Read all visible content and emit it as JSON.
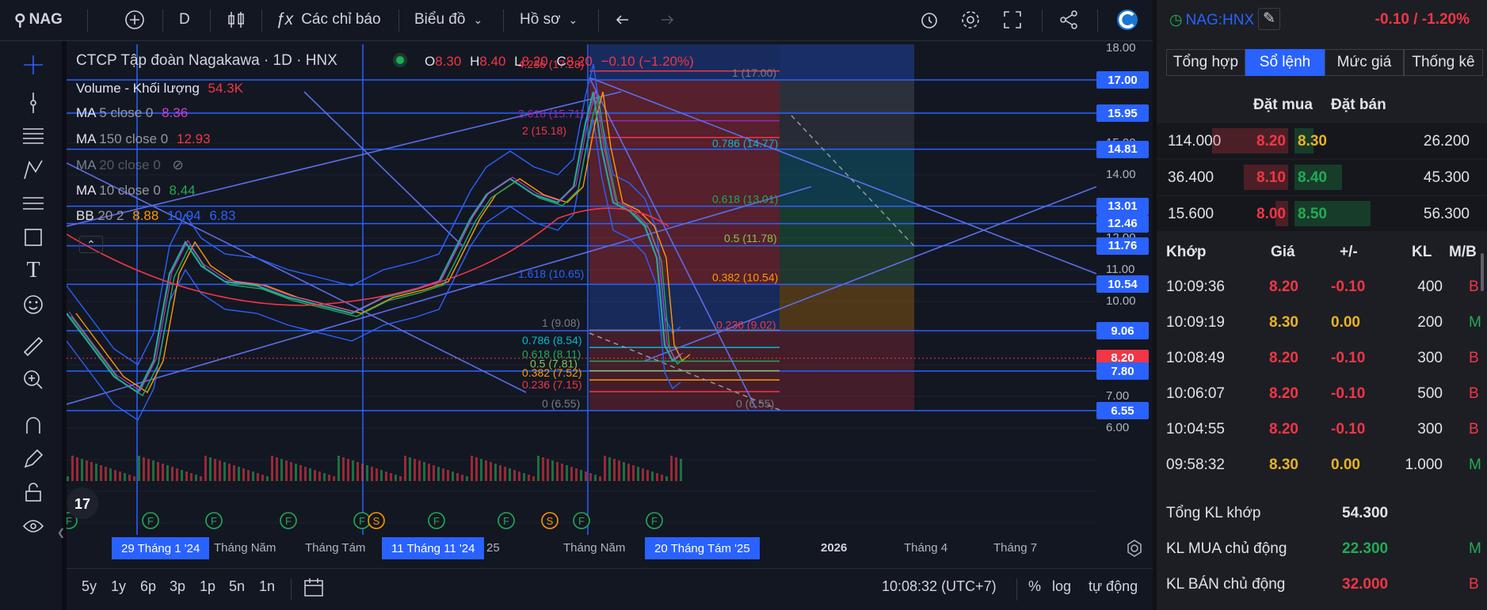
{
  "toolbar": {
    "symbol": "NAG",
    "interval": "D",
    "indicators_label": "Các chỉ báo",
    "chart_label": "Biểu đồ",
    "profile_label": "Hồ sơ"
  },
  "legend": {
    "title": "CTCP Tập đoàn Nagakawa · 1D · HNX",
    "ohlc": {
      "o": "8.30",
      "h": "8.40",
      "l": "8.20",
      "c": "8.20",
      "chg": "−0.10 (−1.20%)"
    },
    "volume": {
      "label": "Volume - Khối lượng",
      "value": "54.3K"
    },
    "indicators": [
      {
        "name": "MA",
        "params": "5 close 0",
        "values": [
          "8.36"
        ],
        "colors": [
          "#d33ad0"
        ]
      },
      {
        "name": "MA",
        "params": "150 close 0",
        "values": [
          "12.93"
        ],
        "colors": [
          "#f23645"
        ]
      },
      {
        "name": "MA",
        "params": "20 close 0",
        "values": [],
        "colors": []
      },
      {
        "name": "MA",
        "params": "10 close 0",
        "values": [
          "8.44"
        ],
        "colors": [
          "#22ab55"
        ]
      },
      {
        "name": "BB",
        "params": "20 2",
        "values": [
          "8.88",
          "10.94",
          "6.83"
        ],
        "colors": [
          "#ff9800",
          "#2962ff",
          "#2962ff"
        ]
      }
    ]
  },
  "price_axis": {
    "ticks": [
      "18.00",
      "15.00",
      "14.00",
      "12.00",
      "11.00",
      "10.00",
      "7.00",
      "6.00"
    ],
    "labels": [
      {
        "value": "17.00",
        "color": "#2962ff"
      },
      {
        "value": "15.95",
        "color": "#2962ff"
      },
      {
        "value": "14.81",
        "color": "#2962ff"
      },
      {
        "value": "13.01",
        "color": "#2962ff"
      },
      {
        "value": "12.46",
        "color": "#2962ff"
      },
      {
        "value": "11.76",
        "color": "#2962ff"
      },
      {
        "value": "10.54",
        "color": "#2962ff"
      },
      {
        "value": "9.06",
        "color": "#2962ff"
      },
      {
        "value": "8.20",
        "color": "#f23645"
      },
      {
        "value": "7.80",
        "color": "#2962ff"
      },
      {
        "value": "6.55",
        "color": "#2962ff"
      }
    ]
  },
  "fib_left": [
    {
      "label": "4.236 (17.28)",
      "color": "#f23645"
    },
    {
      "label": "2.618 (15.71)",
      "color": "#9c27b0"
    },
    {
      "label": "2 (15.18)",
      "color": "#f23645"
    },
    {
      "label": "1.618 (10.65)",
      "color": "#2962ff"
    },
    {
      "label": "1 (9.08)",
      "color": "#787b86"
    },
    {
      "label": "0.786 (8.54)",
      "color": "#00bcd4"
    },
    {
      "label": "0.618 (8.11)",
      "color": "#22ab55"
    },
    {
      "label": "0.5 (7.81)",
      "color": "#8bc34a"
    },
    {
      "label": "0.382 (7.52)",
      "color": "#ff9800"
    },
    {
      "label": "0.236 (7.15)",
      "color": "#f23645"
    },
    {
      "label": "0 (6.55)",
      "color": "#787b86"
    }
  ],
  "fib_right": [
    {
      "label": "1 (17.00)",
      "color": "#787b86"
    },
    {
      "label": "0.786 (14.77)",
      "color": "#00bcd4"
    },
    {
      "label": "0.618 (13.01)",
      "color": "#22ab55"
    },
    {
      "label": "0.5 (11.78)",
      "color": "#8bc34a"
    },
    {
      "label": "0.382 (10.54)",
      "color": "#ff9800"
    },
    {
      "label": "0.236 (9.02)",
      "color": "#f23645"
    },
    {
      "label": "0 (6.55)",
      "color": "#787b86"
    }
  ],
  "time_axis": {
    "labels": [
      "Tháng Năm",
      "Tháng Tám",
      "25",
      "Tháng Năm",
      "2026",
      "Tháng 4",
      "Tháng 7"
    ],
    "selected": [
      "29 Tháng 1 '24",
      "11 Tháng 11 '24",
      "20 Tháng Tám '25"
    ]
  },
  "bottom_bar": {
    "ranges": [
      "5y",
      "1y",
      "6p",
      "3p",
      "1p",
      "5n",
      "1n"
    ],
    "clock": "10:08:32 (UTC+7)",
    "percent": "%",
    "log": "log",
    "auto": "tự động"
  },
  "panel": {
    "symbol": "NAG:HNX",
    "change": "-0.10 / -1.20%",
    "tabs": [
      "Tổng hợp",
      "Sổ lệnh",
      "Mức giá",
      "Thống kê"
    ],
    "active_tab": 1,
    "orderbook_headers": {
      "buy": "Đặt mua",
      "sell": "Đặt bán"
    },
    "orderbook": [
      {
        "bid_vol": "114.000",
        "bid": "8.20",
        "ask": "8.30",
        "ask_vol": "26.200"
      },
      {
        "bid_vol": "36.400",
        "bid": "8.10",
        "ask": "8.40",
        "ask_vol": "45.300"
      },
      {
        "bid_vol": "15.600",
        "bid": "8.00",
        "ask": "8.50",
        "ask_vol": "56.300"
      }
    ],
    "trade_headers": {
      "time": "Khớp",
      "price": "Giá",
      "chg": "+/-",
      "vol": "KL",
      "side": "M/B"
    },
    "trades": [
      {
        "time": "10:09:36",
        "price": "8.20",
        "chg": "-0.10",
        "vol": "400",
        "side": "B"
      },
      {
        "time": "10:09:19",
        "price": "8.30",
        "chg": "0.00",
        "vol": "200",
        "side": "M"
      },
      {
        "time": "10:08:49",
        "price": "8.20",
        "chg": "-0.10",
        "vol": "300",
        "side": "B"
      },
      {
        "time": "10:06:07",
        "price": "8.20",
        "chg": "-0.10",
        "vol": "500",
        "side": "B"
      },
      {
        "time": "10:04:55",
        "price": "8.20",
        "chg": "-0.10",
        "vol": "300",
        "side": "B"
      },
      {
        "time": "09:58:32",
        "price": "8.30",
        "chg": "0.00",
        "vol": "1.000",
        "side": "M"
      }
    ],
    "summary": [
      {
        "label": "Tổng KL khớp",
        "value": "54.300",
        "side": ""
      },
      {
        "label": "KL MUA chủ động",
        "value": "22.300",
        "side": "M"
      },
      {
        "label": "KL BÁN chủ động",
        "value": "32.000",
        "side": "B"
      }
    ]
  }
}
